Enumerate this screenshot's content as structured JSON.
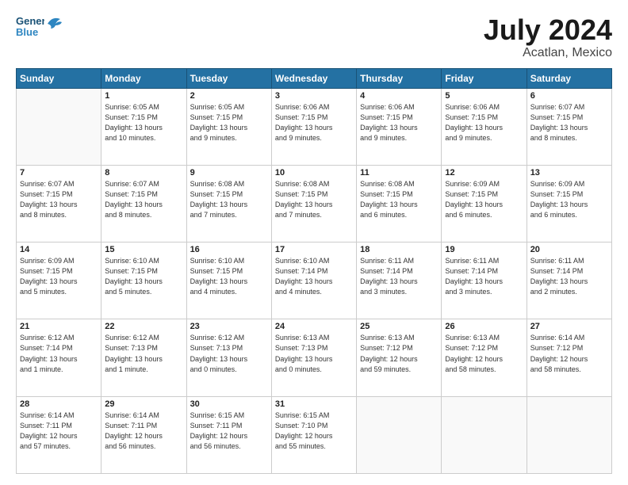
{
  "header": {
    "logo_line1": "General",
    "logo_line2": "Blue",
    "title": "July 2024",
    "location": "Acatlan, Mexico"
  },
  "days_of_week": [
    "Sunday",
    "Monday",
    "Tuesday",
    "Wednesday",
    "Thursday",
    "Friday",
    "Saturday"
  ],
  "weeks": [
    [
      {
        "num": "",
        "info": ""
      },
      {
        "num": "1",
        "info": "Sunrise: 6:05 AM\nSunset: 7:15 PM\nDaylight: 13 hours\nand 10 minutes."
      },
      {
        "num": "2",
        "info": "Sunrise: 6:05 AM\nSunset: 7:15 PM\nDaylight: 13 hours\nand 9 minutes."
      },
      {
        "num": "3",
        "info": "Sunrise: 6:06 AM\nSunset: 7:15 PM\nDaylight: 13 hours\nand 9 minutes."
      },
      {
        "num": "4",
        "info": "Sunrise: 6:06 AM\nSunset: 7:15 PM\nDaylight: 13 hours\nand 9 minutes."
      },
      {
        "num": "5",
        "info": "Sunrise: 6:06 AM\nSunset: 7:15 PM\nDaylight: 13 hours\nand 9 minutes."
      },
      {
        "num": "6",
        "info": "Sunrise: 6:07 AM\nSunset: 7:15 PM\nDaylight: 13 hours\nand 8 minutes."
      }
    ],
    [
      {
        "num": "7",
        "info": "Sunrise: 6:07 AM\nSunset: 7:15 PM\nDaylight: 13 hours\nand 8 minutes."
      },
      {
        "num": "8",
        "info": "Sunrise: 6:07 AM\nSunset: 7:15 PM\nDaylight: 13 hours\nand 8 minutes."
      },
      {
        "num": "9",
        "info": "Sunrise: 6:08 AM\nSunset: 7:15 PM\nDaylight: 13 hours\nand 7 minutes."
      },
      {
        "num": "10",
        "info": "Sunrise: 6:08 AM\nSunset: 7:15 PM\nDaylight: 13 hours\nand 7 minutes."
      },
      {
        "num": "11",
        "info": "Sunrise: 6:08 AM\nSunset: 7:15 PM\nDaylight: 13 hours\nand 6 minutes."
      },
      {
        "num": "12",
        "info": "Sunrise: 6:09 AM\nSunset: 7:15 PM\nDaylight: 13 hours\nand 6 minutes."
      },
      {
        "num": "13",
        "info": "Sunrise: 6:09 AM\nSunset: 7:15 PM\nDaylight: 13 hours\nand 6 minutes."
      }
    ],
    [
      {
        "num": "14",
        "info": "Sunrise: 6:09 AM\nSunset: 7:15 PM\nDaylight: 13 hours\nand 5 minutes."
      },
      {
        "num": "15",
        "info": "Sunrise: 6:10 AM\nSunset: 7:15 PM\nDaylight: 13 hours\nand 5 minutes."
      },
      {
        "num": "16",
        "info": "Sunrise: 6:10 AM\nSunset: 7:15 PM\nDaylight: 13 hours\nand 4 minutes."
      },
      {
        "num": "17",
        "info": "Sunrise: 6:10 AM\nSunset: 7:14 PM\nDaylight: 13 hours\nand 4 minutes."
      },
      {
        "num": "18",
        "info": "Sunrise: 6:11 AM\nSunset: 7:14 PM\nDaylight: 13 hours\nand 3 minutes."
      },
      {
        "num": "19",
        "info": "Sunrise: 6:11 AM\nSunset: 7:14 PM\nDaylight: 13 hours\nand 3 minutes."
      },
      {
        "num": "20",
        "info": "Sunrise: 6:11 AM\nSunset: 7:14 PM\nDaylight: 13 hours\nand 2 minutes."
      }
    ],
    [
      {
        "num": "21",
        "info": "Sunrise: 6:12 AM\nSunset: 7:14 PM\nDaylight: 13 hours\nand 1 minute."
      },
      {
        "num": "22",
        "info": "Sunrise: 6:12 AM\nSunset: 7:13 PM\nDaylight: 13 hours\nand 1 minute."
      },
      {
        "num": "23",
        "info": "Sunrise: 6:12 AM\nSunset: 7:13 PM\nDaylight: 13 hours\nand 0 minutes."
      },
      {
        "num": "24",
        "info": "Sunrise: 6:13 AM\nSunset: 7:13 PM\nDaylight: 13 hours\nand 0 minutes."
      },
      {
        "num": "25",
        "info": "Sunrise: 6:13 AM\nSunset: 7:12 PM\nDaylight: 12 hours\nand 59 minutes."
      },
      {
        "num": "26",
        "info": "Sunrise: 6:13 AM\nSunset: 7:12 PM\nDaylight: 12 hours\nand 58 minutes."
      },
      {
        "num": "27",
        "info": "Sunrise: 6:14 AM\nSunset: 7:12 PM\nDaylight: 12 hours\nand 58 minutes."
      }
    ],
    [
      {
        "num": "28",
        "info": "Sunrise: 6:14 AM\nSunset: 7:11 PM\nDaylight: 12 hours\nand 57 minutes."
      },
      {
        "num": "29",
        "info": "Sunrise: 6:14 AM\nSunset: 7:11 PM\nDaylight: 12 hours\nand 56 minutes."
      },
      {
        "num": "30",
        "info": "Sunrise: 6:15 AM\nSunset: 7:11 PM\nDaylight: 12 hours\nand 56 minutes."
      },
      {
        "num": "31",
        "info": "Sunrise: 6:15 AM\nSunset: 7:10 PM\nDaylight: 12 hours\nand 55 minutes."
      },
      {
        "num": "",
        "info": ""
      },
      {
        "num": "",
        "info": ""
      },
      {
        "num": "",
        "info": ""
      }
    ]
  ]
}
